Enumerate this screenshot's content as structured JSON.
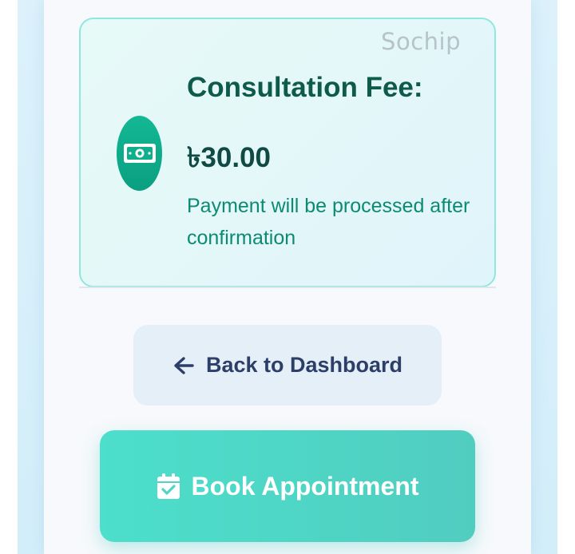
{
  "watermark": "Sochip",
  "fee_card": {
    "title": "Consultation Fee:",
    "amount": "৳30.00",
    "note": "Payment will be processed after confirmation",
    "icon": "money-bill-icon",
    "accent_color": "#0fae8c"
  },
  "actions": {
    "back_label": "Back to Dashboard",
    "back_icon": "arrow-left-icon",
    "book_label": "Book Appointment",
    "book_icon": "calendar-check-icon"
  },
  "colors": {
    "card_border": "#8ee8df",
    "title": "#0f5b4b",
    "note": "#0c8a72",
    "back_bg": "#e4eff7",
    "back_text": "#2d3f68",
    "book_bg": "#4cdfcb"
  }
}
